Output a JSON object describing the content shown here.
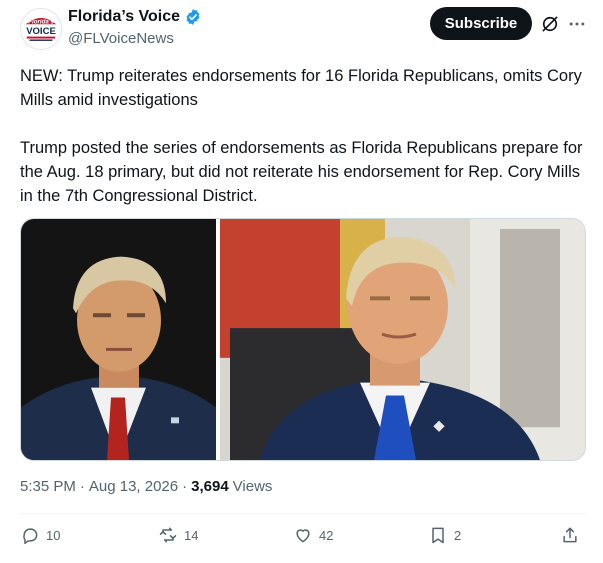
{
  "account": {
    "display_name": "Florida’s Voice",
    "handle": "@FLVoiceNews",
    "verified": true,
    "avatar_logo": {
      "line1": "Florida's",
      "line2": "VOICE"
    }
  },
  "header": {
    "subscribe_label": "Subscribe",
    "grok_icon": "grok-icon",
    "more_icon": "more-horizontal-icon"
  },
  "post": {
    "paragraph1": "NEW: Trump reiterates endorsements for 16 Florida Republicans, omits Cory Mills amid investigations",
    "paragraph2": "Trump posted the series of endorsements as Florida Republicans prepare for the Aug. 18 primary, but did not reiterate his endorsement for Rep. Cory Mills in the 7th Congressional District."
  },
  "meta": {
    "time": "5:35 PM",
    "separator": "·",
    "date": "Aug 13, 2026",
    "views_count": "3,694",
    "views_label": "Views"
  },
  "actions": {
    "replies": "10",
    "reposts": "14",
    "likes": "42",
    "bookmarks": "2"
  },
  "colors": {
    "text": "#0f1419",
    "muted": "#536471",
    "verified_blue": "#1d9bf0",
    "button_dark": "#0f1419"
  }
}
